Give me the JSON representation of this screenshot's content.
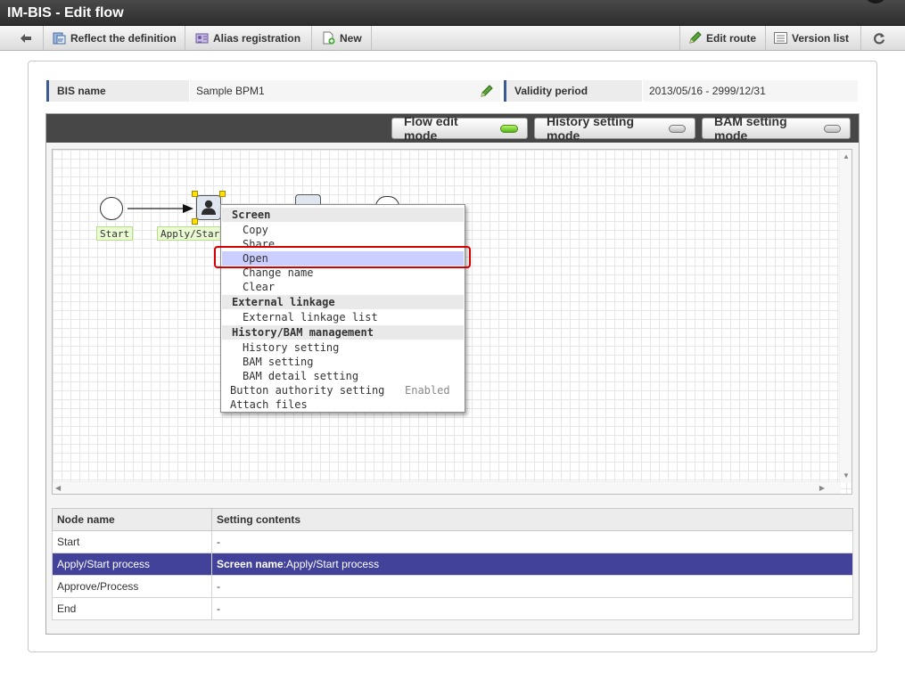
{
  "window": {
    "title": "IM-BIS - Edit flow"
  },
  "toolbar": {
    "back_icon": "back-arrow-icon",
    "reflect": "Reflect the definition",
    "alias": "Alias registration",
    "new": "New",
    "edit_route": "Edit route",
    "version_list": "Version list",
    "refresh_icon": "refresh-icon"
  },
  "info": {
    "bis_name_label": "BIS name",
    "bis_name_value": "Sample BPM1",
    "validity_label": "Validity period",
    "validity_value": "2013/05/16 - 2999/12/31"
  },
  "modes": {
    "flow_edit": "Flow edit mode",
    "flow_edit_on": true,
    "history": "History setting mode",
    "history_on": false,
    "bam": "BAM setting mode",
    "bam_on": false
  },
  "flow": {
    "start_label": "Start",
    "apply_label": "Apply/Start"
  },
  "context_menu": {
    "screen_header": "Screen",
    "copy": "Copy",
    "share": "Share",
    "open": "Open",
    "change_name": "Change name",
    "clear": "Clear",
    "external_header": "External linkage",
    "external_list": "External linkage list",
    "history_header": "History/BAM management",
    "history_setting": "History setting",
    "bam_setting": "BAM setting",
    "bam_detail": "BAM detail setting",
    "button_authority": "Button authority setting",
    "button_authority_status": "Enabled",
    "attach_files": "Attach files",
    "selected_item": "Open"
  },
  "table": {
    "headers": [
      "Node name",
      "Setting contents"
    ],
    "rows": [
      {
        "name": "Start",
        "content_label": "",
        "content": "-"
      },
      {
        "name": "Apply/Start process",
        "content_label": "Screen name",
        "content": ":Apply/Start process",
        "selected": true
      },
      {
        "name": "Approve/Process",
        "content_label": "",
        "content": "-"
      },
      {
        "name": "End",
        "content_label": "",
        "content": "-"
      }
    ]
  },
  "colors": {
    "header_dark": "#2e2e2e",
    "selection_row": "#42429b",
    "menu_highlight": "#cbcfff",
    "callout_red": "#d40000",
    "led_on": "#55b619"
  }
}
